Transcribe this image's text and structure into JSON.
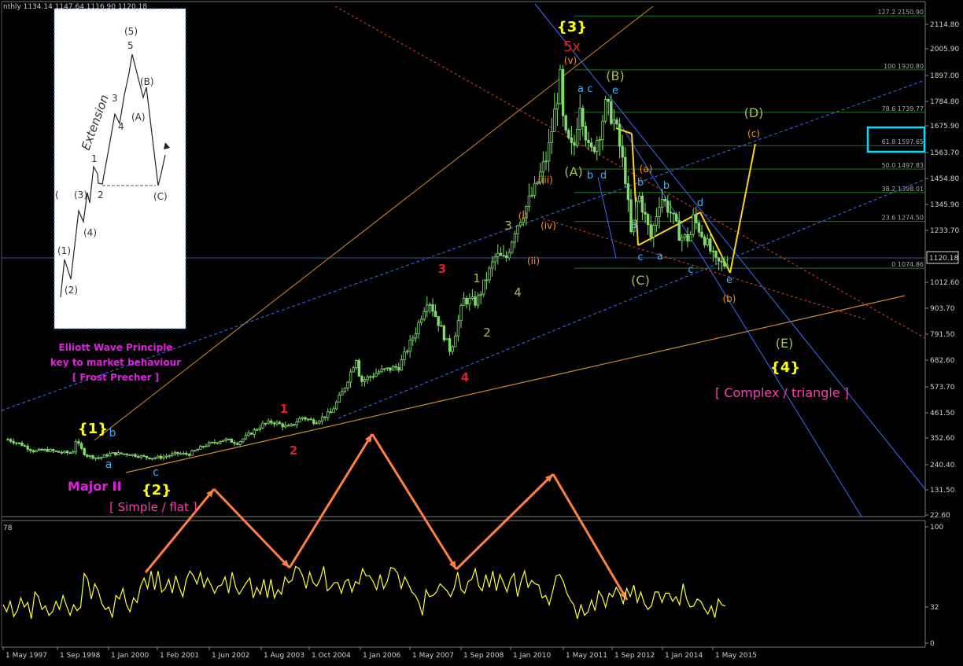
{
  "header": {
    "info": "nthly  1134.14 1147.64 1116.90 1120.18"
  },
  "colors": {
    "background": "#000000",
    "candles": "#7fdc6a",
    "oscillator": "#ffff33",
    "arrows": "#ff8040",
    "red_labels": "#e02020",
    "yellow_labels": "#ffff00",
    "olive_labels": "#a0c050",
    "cyan_labels": "#3ab0ff",
    "orange_labels": "#ff8c1a",
    "magenta_labels": "#ff00ff",
    "fib_lines": "#1f7a1f",
    "highlight_box": "#00e0ff"
  },
  "inset": {
    "label_extension": "Extension",
    "waves": [
      "(1)",
      "(2)",
      "(3)",
      "(4)",
      "1",
      "2",
      "3",
      "4",
      "(5)",
      "5",
      "(A)",
      "(B)",
      "(C)"
    ],
    "partial_left": "("
  },
  "annotations": {
    "book_title_line1": "Elliott Wave Principle",
    "book_title_line2": "key to market behaviour",
    "book_authors": "[ Frost  Precher ]",
    "major_ii": "Major II",
    "simple_flat": "[ Simple / flat ]",
    "complex_triangle": "[ Complex / triangle ]",
    "extension_5x": "5x",
    "wave_labels": {
      "yellow": [
        "{1}",
        "{2}",
        "{3}",
        "{4}"
      ],
      "red": [
        "1",
        "2",
        "3",
        "4"
      ],
      "olive_upper": [
        "1",
        "2",
        "3",
        "4"
      ],
      "olive_corrective": [
        "(A)",
        "(B)",
        "(C)",
        "(D)",
        "(E)"
      ],
      "orange": [
        "(i)",
        "(ii)",
        "(iii)",
        "(iv)",
        "(v)",
        "(a)",
        "(b)",
        "(c)"
      ],
      "cyan": [
        "a",
        "b",
        "c",
        "a",
        "c",
        "e",
        "b",
        "d",
        "a",
        "b",
        "c",
        "a",
        "b",
        "c",
        "d",
        "e"
      ]
    }
  },
  "chart_data": [
    {
      "type": "candlestick",
      "title": "",
      "x_ticks": [
        "1 May 1997",
        "1 Sep 1998",
        "1 Jan 2000",
        "1 Feb 2001",
        "1 Jun 2002",
        "1 Aug 2003",
        "1 Oct 2004",
        "1 Jan 2006",
        "1 May 2007",
        "1 Sep 2008",
        "1 Jan 2010",
        "1 May 2011",
        "1 Sep 2012",
        "1 Jan 2014",
        "1 May 2015"
      ],
      "y_ticks": [
        "2114.80",
        "2005.90",
        "1897.00",
        "1784.80",
        "1675.90",
        "1563.70",
        "1454.80",
        "1345.90",
        "1233.70",
        "1120.18",
        "1012.60",
        "903.70",
        "791.50",
        "682.60",
        "573.70",
        "461.50",
        "352.60",
        "240.40",
        "131.50",
        "22.60"
      ],
      "current_price": 1120.18,
      "ylim": [
        22.6,
        2200
      ],
      "fibonacci_levels": [
        {
          "label": "127.2 2150.90",
          "value": 2150.9
        },
        {
          "label": "100 1920.80",
          "value": 1920.8
        },
        {
          "label": "78.6 1739.77",
          "value": 1739.77
        },
        {
          "label": "61.8 1597.65",
          "value": 1597.65
        },
        {
          "label": "50.0 1497.83",
          "value": 1497.83
        },
        {
          "label": "38.2 1398.01",
          "value": 1398.01
        },
        {
          "label": "23.6 1274.50",
          "value": 1274.5
        },
        {
          "label": "0 1074.86",
          "value": 1074.86
        }
      ],
      "monthly_close_path": [
        [
          "1997-05",
          345
        ],
        [
          "1997-09",
          325
        ],
        [
          "1998-01",
          295
        ],
        [
          "1998-05",
          300
        ],
        [
          "1998-09",
          290
        ],
        [
          "1999-01",
          287
        ],
        [
          "1999-02",
          340
        ],
        [
          "1999-05",
          278
        ],
        [
          "1999-09",
          265
        ],
        [
          "2000-01",
          285
        ],
        [
          "2000-06",
          283
        ],
        [
          "2001-01",
          266
        ],
        [
          "2001-05",
          270
        ],
        [
          "2001-09",
          285
        ],
        [
          "2002-01",
          282
        ],
        [
          "2002-06",
          320
        ],
        [
          "2002-12",
          345
        ],
        [
          "2003-04",
          330
        ],
        [
          "2003-08",
          370
        ],
        [
          "2003-12",
          410
        ],
        [
          "2004-03",
          420
        ],
        [
          "2004-08",
          395
        ],
        [
          "2004-12",
          440
        ],
        [
          "2005-04",
          420
        ],
        [
          "2005-09",
          460
        ],
        [
          "2006-01",
          560
        ],
        [
          "2006-05",
          700
        ],
        [
          "2006-06",
          590
        ],
        [
          "2006-12",
          635
        ],
        [
          "2007-06",
          655
        ],
        [
          "2007-11",
          800
        ],
        [
          "2008-03",
          950
        ],
        [
          "2008-10",
          720
        ],
        [
          "2009-02",
          940
        ],
        [
          "2009-06",
          930
        ],
        [
          "2009-12",
          1130
        ],
        [
          "2010-03",
          1110
        ],
        [
          "2010-06",
          1245
        ],
        [
          "2010-12",
          1410
        ],
        [
          "2011-04",
          1560
        ],
        [
          "2011-08",
          1890
        ],
        [
          "2011-09",
          1650
        ],
        [
          "2011-12",
          1570
        ],
        [
          "2012-02",
          1790
        ],
        [
          "2012-05",
          1555
        ],
        [
          "2012-08",
          1650
        ],
        [
          "2012-10",
          1770
        ],
        [
          "2013-01",
          1690
        ],
        [
          "2013-04",
          1470
        ],
        [
          "2013-06",
          1195
        ],
        [
          "2013-08",
          1400
        ],
        [
          "2013-12",
          1205
        ],
        [
          "2014-03",
          1385
        ],
        [
          "2014-06",
          1315
        ],
        [
          "2014-09",
          1210
        ],
        [
          "2014-12",
          1200
        ],
        [
          "2015-01",
          1290
        ],
        [
          "2015-05",
          1190
        ],
        [
          "2015-08",
          1100
        ],
        [
          "2015-11",
          1090
        ],
        [
          "2015-12",
          1120
        ]
      ]
    },
    {
      "type": "line",
      "title": "",
      "ylabel": "",
      "indicator_value_label": "78",
      "ylim": [
        0,
        100
      ],
      "y_ticks": [
        "100",
        "32",
        "0"
      ],
      "series": [
        {
          "values": [
            33,
            27,
            36,
            23,
            28,
            39,
            31,
            35,
            21,
            44,
            40,
            29,
            32,
            24,
            27,
            36,
            29,
            41,
            32,
            24,
            33,
            28,
            31,
            60,
            55,
            38,
            51,
            45,
            34,
            29,
            31,
            22,
            41,
            38,
            47,
            33,
            27,
            39,
            35,
            49,
            56,
            47,
            62,
            46,
            62,
            44,
            47,
            55,
            43,
            58,
            48,
            40,
            55,
            62,
            58,
            51,
            61,
            48,
            56,
            50,
            43,
            49,
            50,
            57,
            43,
            61,
            48,
            42,
            47,
            52,
            56,
            39,
            48,
            42,
            55,
            39,
            55,
            39,
            46,
            42,
            57,
            52,
            54,
            66,
            64,
            58,
            47,
            61,
            52,
            49,
            55,
            66,
            45,
            48,
            52,
            52,
            43,
            53,
            55,
            44,
            53,
            51,
            64,
            58,
            58,
            53,
            46,
            59,
            47,
            53,
            65,
            64,
            60,
            47,
            57,
            51,
            44,
            41,
            35,
            24,
            46,
            40,
            41,
            44,
            51,
            48,
            45,
            40,
            47,
            61,
            46,
            43,
            53,
            55,
            64,
            49,
            45,
            59,
            48,
            62,
            45,
            59,
            52,
            44,
            55,
            60,
            40,
            53,
            62,
            48,
            54,
            51,
            50,
            39,
            41,
            33,
            45,
            58,
            59,
            53,
            43,
            37,
            33,
            21,
            33,
            24,
            27,
            37,
            28,
            45,
            40,
            31,
            43,
            40,
            48,
            43,
            34,
            47,
            40,
            50,
            35,
            44,
            34,
            29,
            32,
            44,
            44,
            35,
            43,
            43,
            36,
            40,
            33,
            51,
            38,
            31,
            32,
            38,
            36,
            30,
            25,
            32,
            22,
            38,
            33,
            32
          ]
        }
      ]
    }
  ]
}
